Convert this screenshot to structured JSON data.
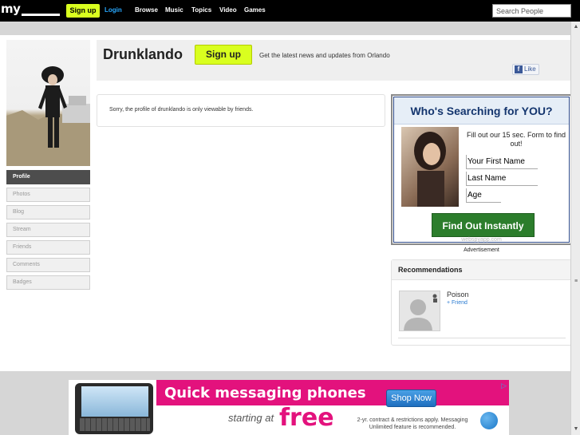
{
  "topbar": {
    "logo": "my",
    "signup_label": "Sign up",
    "login_label": "Login",
    "nav": [
      "Browse",
      "Music",
      "Topics",
      "Video",
      "Games"
    ],
    "search_placeholder": "Search People"
  },
  "profile": {
    "name": "Drunklando",
    "signup_label": "Sign up",
    "tagline": "Get the latest news and updates from Orlando",
    "fb_like": "Like",
    "notice": "Sorry, the profile of drunklando is only viewable by friends."
  },
  "sidebar": {
    "items": [
      {
        "label": "Profile",
        "active": true
      },
      {
        "label": "Photos",
        "active": false
      },
      {
        "label": "Blog",
        "active": false
      },
      {
        "label": "Stream",
        "active": false
      },
      {
        "label": "Friends",
        "active": false
      },
      {
        "label": "Comments",
        "active": false
      },
      {
        "label": "Badges",
        "active": false
      }
    ]
  },
  "ad": {
    "headline": "Who's Searching for YOU?",
    "text": "Fill out our 15 sec. Form to find out!",
    "fields": [
      "Your First Name",
      "Last Name",
      "Age"
    ],
    "cta": "Find Out Instantly",
    "domain": "webspyapp.com",
    "label": "Advertisement"
  },
  "recommendations": {
    "title": "Recommendations",
    "items": [
      {
        "name": "Poison",
        "action": "+ Friend"
      }
    ]
  },
  "bottom_ad": {
    "headline": "Quick messaging phones",
    "shop": "Shop Now",
    "starting_at": "starting at",
    "free": "free",
    "terms": "2-yr. contract & restrictions apply. Messaging Unlimited feature is recommended."
  },
  "colors": {
    "accent_green": "#d9ff1f",
    "link_blue": "#28a8ff",
    "ad_pink": "#e3127d"
  }
}
